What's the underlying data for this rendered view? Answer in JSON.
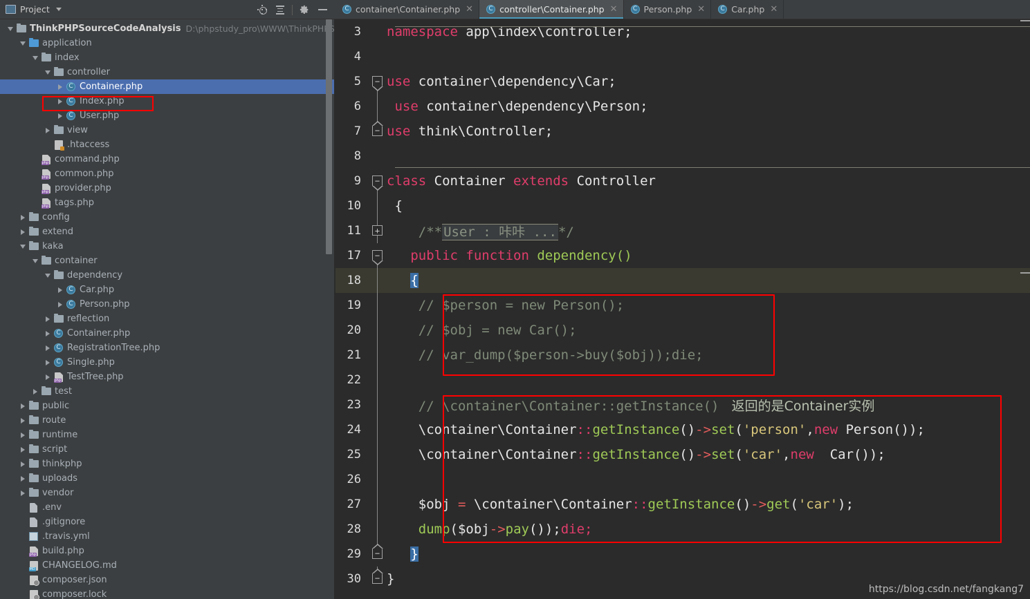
{
  "window": {
    "project_panel_title": "Project",
    "watermark": "https://blog.csdn.net/fangkang7"
  },
  "toolbar": {
    "locate_icon": "locate-icon",
    "collapse_icon": "collapse-all-icon",
    "settings_icon": "gear-icon",
    "minimize_icon": "minimize-icon"
  },
  "tabs": [
    {
      "label": "container\\Container.php",
      "active": false,
      "icon": "php-class-icon"
    },
    {
      "label": "controller\\Container.php",
      "active": true,
      "icon": "php-class-icon"
    },
    {
      "label": "Person.php",
      "active": false,
      "icon": "php-class-icon"
    },
    {
      "label": "Car.php",
      "active": false,
      "icon": "php-class-icon"
    }
  ],
  "tree": [
    {
      "indent": 0,
      "arrow": "open",
      "icon": "folder",
      "label": "ThinkPHPSourceCodeAnalysis",
      "bold": true,
      "path": "D:\\phpstudy_pro\\WWW\\ThinkPHPSourceCo"
    },
    {
      "indent": 1,
      "arrow": "open",
      "icon": "folder-blue",
      "label": "application"
    },
    {
      "indent": 2,
      "arrow": "open",
      "icon": "folder",
      "label": "index"
    },
    {
      "indent": 3,
      "arrow": "open",
      "icon": "folder",
      "label": "controller"
    },
    {
      "indent": 4,
      "arrow": "closed",
      "icon": "php-class",
      "label": "Container.php",
      "selected": true
    },
    {
      "indent": 4,
      "arrow": "closed",
      "icon": "php-class",
      "label": "Index.php"
    },
    {
      "indent": 4,
      "arrow": "closed",
      "icon": "php-class",
      "label": "User.php"
    },
    {
      "indent": 3,
      "arrow": "closed",
      "icon": "folder",
      "label": "view"
    },
    {
      "indent": 3,
      "arrow": "none",
      "icon": "htaccess",
      "label": ".htaccess"
    },
    {
      "indent": 2,
      "arrow": "none",
      "icon": "php-file",
      "label": "command.php"
    },
    {
      "indent": 2,
      "arrow": "none",
      "icon": "php-file",
      "label": "common.php"
    },
    {
      "indent": 2,
      "arrow": "none",
      "icon": "php-file",
      "label": "provider.php"
    },
    {
      "indent": 2,
      "arrow": "none",
      "icon": "php-file",
      "label": "tags.php"
    },
    {
      "indent": 1,
      "arrow": "closed",
      "icon": "folder",
      "label": "config"
    },
    {
      "indent": 1,
      "arrow": "closed",
      "icon": "folder",
      "label": "extend"
    },
    {
      "indent": 1,
      "arrow": "open",
      "icon": "folder",
      "label": "kaka"
    },
    {
      "indent": 2,
      "arrow": "open",
      "icon": "folder",
      "label": "container"
    },
    {
      "indent": 3,
      "arrow": "open",
      "icon": "folder",
      "label": "dependency"
    },
    {
      "indent": 4,
      "arrow": "closed",
      "icon": "php-class",
      "label": "Car.php"
    },
    {
      "indent": 4,
      "arrow": "closed",
      "icon": "php-class",
      "label": "Person.php"
    },
    {
      "indent": 3,
      "arrow": "closed",
      "icon": "folder",
      "label": "reflection"
    },
    {
      "indent": 3,
      "arrow": "closed",
      "icon": "php-class",
      "label": "Container.php"
    },
    {
      "indent": 3,
      "arrow": "closed",
      "icon": "php-class",
      "label": "RegistrationTree.php"
    },
    {
      "indent": 3,
      "arrow": "closed",
      "icon": "php-class",
      "label": "Single.php"
    },
    {
      "indent": 3,
      "arrow": "closed",
      "icon": "php-file",
      "label": "TestTree.php"
    },
    {
      "indent": 2,
      "arrow": "closed",
      "icon": "folder",
      "label": "test"
    },
    {
      "indent": 1,
      "arrow": "closed",
      "icon": "folder",
      "label": "public"
    },
    {
      "indent": 1,
      "arrow": "closed",
      "icon": "folder",
      "label": "route"
    },
    {
      "indent": 1,
      "arrow": "closed",
      "icon": "folder",
      "label": "runtime"
    },
    {
      "indent": 1,
      "arrow": "closed",
      "icon": "folder",
      "label": "script"
    },
    {
      "indent": 1,
      "arrow": "closed",
      "icon": "folder",
      "label": "thinkphp"
    },
    {
      "indent": 1,
      "arrow": "closed",
      "icon": "folder",
      "label": "uploads"
    },
    {
      "indent": 1,
      "arrow": "closed",
      "icon": "folder",
      "label": "vendor"
    },
    {
      "indent": 1,
      "arrow": "none",
      "icon": "plain",
      "label": ".env"
    },
    {
      "indent": 1,
      "arrow": "none",
      "icon": "plain",
      "label": ".gitignore"
    },
    {
      "indent": 1,
      "arrow": "none",
      "icon": "yml",
      "label": ".travis.yml"
    },
    {
      "indent": 1,
      "arrow": "none",
      "icon": "php-file",
      "label": "build.php"
    },
    {
      "indent": 1,
      "arrow": "none",
      "icon": "md",
      "label": "CHANGELOG.md"
    },
    {
      "indent": 1,
      "arrow": "none",
      "icon": "json",
      "label": "composer.json"
    },
    {
      "indent": 1,
      "arrow": "none",
      "icon": "json",
      "label": "composer.lock"
    }
  ],
  "code": {
    "lines": [
      {
        "no": "3",
        "fold": "none",
        "current": false
      },
      {
        "no": "4",
        "fold": "none",
        "current": false
      },
      {
        "no": "5",
        "fold": "tip-down",
        "current": false
      },
      {
        "no": "6",
        "fold": "bar",
        "current": false
      },
      {
        "no": "7",
        "fold": "tip-up",
        "current": false
      },
      {
        "no": "8",
        "fold": "none",
        "current": false
      },
      {
        "no": "9",
        "fold": "tip-down",
        "current": false
      },
      {
        "no": "10",
        "fold": "bar",
        "current": false
      },
      {
        "no": "11",
        "fold": "plus",
        "current": false
      },
      {
        "no": "17",
        "fold": "tip-down",
        "current": false
      },
      {
        "no": "18",
        "fold": "bar",
        "current": true
      },
      {
        "no": "19",
        "fold": "bar",
        "current": false
      },
      {
        "no": "20",
        "fold": "bar",
        "current": false
      },
      {
        "no": "21",
        "fold": "bar",
        "current": false
      },
      {
        "no": "22",
        "fold": "bar",
        "current": false
      },
      {
        "no": "23",
        "fold": "bar",
        "current": false
      },
      {
        "no": "24",
        "fold": "bar",
        "current": false
      },
      {
        "no": "25",
        "fold": "bar",
        "current": false
      },
      {
        "no": "26",
        "fold": "bar",
        "current": false
      },
      {
        "no": "27",
        "fold": "bar",
        "current": false
      },
      {
        "no": "28",
        "fold": "bar",
        "current": false
      },
      {
        "no": "29",
        "fold": "tip-up",
        "current": false
      },
      {
        "no": "30",
        "fold": "tip-up",
        "current": false
      }
    ],
    "text": {
      "l3_kw": "namespace",
      "l3_rest": " app\\index\\controller;",
      "l5_kw": "use",
      "l5_rest": " container\\dependency\\Car;",
      "l6_kw": "use",
      "l6_rest": " container\\dependency\\Person;",
      "l7_kw": "use",
      "l7_rest": " think\\Controller;",
      "l9_kw1": "class",
      "l9_name": " Container ",
      "l9_kw2": "extends",
      "l9_parent": " Controller",
      "l10_brace": "{",
      "l11_open": "/**",
      "l11_fold": "User : 咔咔 ...",
      "l11_close": "*/",
      "l17_kw1": "public",
      "l17_kw2": " function ",
      "l17_fn": "dependency()",
      "l18_brace": "{",
      "l19": "// $person = new Person();",
      "l20": "// $obj = new Car();",
      "l21": "// var_dump($person->buy($obj));die;",
      "l23_cmt": "// \\container\\Container::getInstance()",
      "l23_cjk": "   返回的是Container实例",
      "l24_a": "\\container\\Container",
      "l24_colons": "::",
      "l24_fn": "getInstance",
      "l24_p1": "()",
      "l24_arrow": "->",
      "l24_set": "set",
      "l24_p2": "(",
      "l24_str": "'person'",
      "l24_comma": ",",
      "l24_new": "new",
      "l24_cls": " Person()",
      "l24_end": ");",
      "l25_a": "\\container\\Container",
      "l25_colons": "::",
      "l25_fn": "getInstance",
      "l25_p1": "()",
      "l25_arrow": "->",
      "l25_set": "set",
      "l25_p2": "(",
      "l25_str": "'car'",
      "l25_comma": ",",
      "l25_new": "new",
      "l25_cls": "  Car()",
      "l25_end": ");",
      "l27_var": "$obj",
      "l27_eq": " = ",
      "l27_a": "\\container\\Container",
      "l27_colons": "::",
      "l27_fn": "getInstance",
      "l27_p1": "()",
      "l27_arrow": "->",
      "l27_get": "get",
      "l27_p2": "(",
      "l27_str": "'car'",
      "l27_end": ");",
      "l28_dump": "dump",
      "l28_p1": "(",
      "l28_var": "$obj",
      "l28_arrow": "->",
      "l28_pay": "pay",
      "l28_p2": "());",
      "l28_die": "die;",
      "l29_brace": "}",
      "l30_brace": "}"
    }
  },
  "colors": {
    "selection_blue": "#4b6eaf",
    "annotation_red": "#ff0000",
    "tab_accent": "#4a9bbd",
    "keyword_pink": "#e03d6b",
    "function_green": "#9fca56",
    "string_yellow": "#d9c77b",
    "comment_gray": "#7f8a78",
    "editor_bg": "#2b2b2b",
    "panel_bg": "#3c3f41"
  }
}
